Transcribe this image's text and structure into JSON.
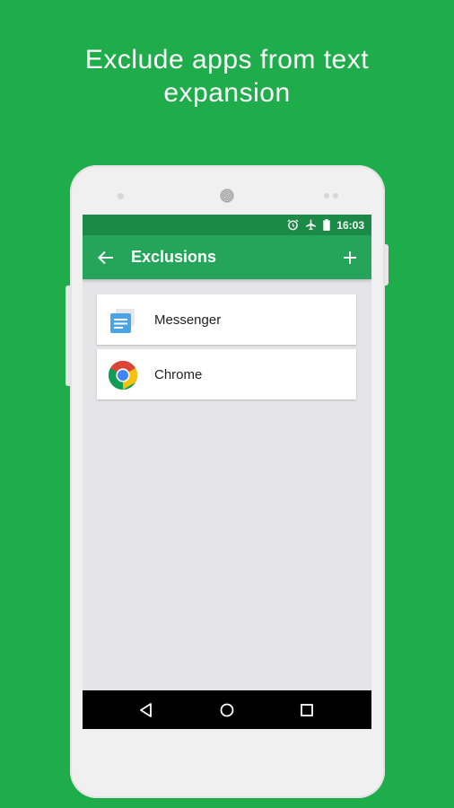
{
  "headline": {
    "line1": "Exclude apps from text",
    "line2": "expansion"
  },
  "status_bar": {
    "time": "16:03",
    "icons": [
      "alarm-icon",
      "airplane-icon",
      "battery-icon"
    ]
  },
  "app_bar": {
    "title": "Exclusions",
    "back_icon": "arrow-left-icon",
    "add_icon": "plus-icon"
  },
  "exclusions": [
    {
      "label": "Messenger",
      "icon": "messenger-icon"
    },
    {
      "label": "Chrome",
      "icon": "chrome-icon"
    }
  ],
  "nav_bar": {
    "buttons": [
      "back-triangle-icon",
      "home-circle-icon",
      "recents-square-icon"
    ]
  },
  "colors": {
    "background": "#1fac4b",
    "status_bar": "#1a8a46",
    "app_bar": "#24a55a",
    "screen": "#e5e5e7"
  }
}
